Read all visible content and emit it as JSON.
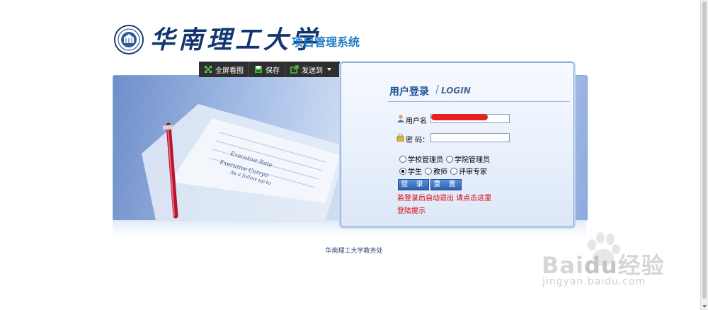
{
  "header": {
    "university_name": "华南理工大学",
    "system_title": "项目管理系统"
  },
  "toolbar": {
    "fullscreen_label": "全屏看图",
    "save_label": "保存",
    "send_to_label": "发送到"
  },
  "banner": {
    "paper_lines": [
      "Executive Rate",
      "Executive Carryo",
      "As a follow up to"
    ]
  },
  "login": {
    "title": "用户登录",
    "separator": "/",
    "subtitle": "LOGIN",
    "username_label": "用户名",
    "password_label": "密 码：",
    "password_value": "",
    "roles_row1": [
      "学校管理员",
      "学院管理员"
    ],
    "roles_row2": [
      "学生",
      "教师",
      "评审专家"
    ],
    "selected_role": "学生",
    "login_button": "登 录",
    "reset_button": "重 置",
    "auto_logout_notice": "若登录后自动退出 请点击这里",
    "login_hint": "登陆提示"
  },
  "footer": {
    "text": "华南理工大学教务处"
  },
  "watermark": {
    "brand": "Bai",
    "brand_du": "du",
    "brand_jy": "经验",
    "url": "jingyan.baidu.com"
  },
  "colors": {
    "title_blue": "#1e7bc8",
    "university_blue": "#12366e",
    "warning_red": "#e00000"
  }
}
